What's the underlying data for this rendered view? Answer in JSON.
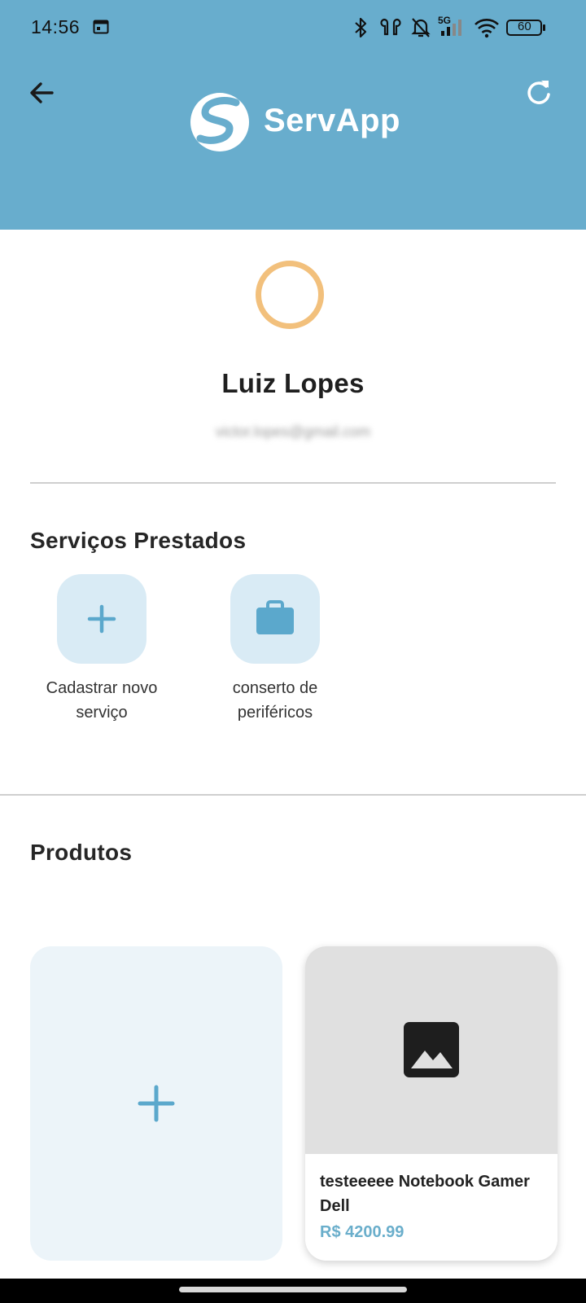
{
  "status_bar": {
    "time": "14:56",
    "network": "5G",
    "battery": "60"
  },
  "header": {
    "app_name": "ServApp",
    "background_color": "#68adcd"
  },
  "profile": {
    "name": "Luiz Lopes",
    "email": "victor.lopes@gmail.com",
    "avatar_ring_color": "#f2c07c"
  },
  "services": {
    "title": "Serviços Prestados",
    "items": [
      {
        "label_line1": "Cadastrar novo",
        "label_line2": "serviço",
        "icon": "plus-icon"
      },
      {
        "label_line1": "conserto de",
        "label_line2": "periféricos",
        "icon": "briefcase-icon"
      }
    ]
  },
  "products": {
    "title": "Produtos",
    "items": [
      {
        "title": "testeeeee Notebook Gamer Dell",
        "price": "R$ 4200.99",
        "icon": "image-placeholder-icon"
      }
    ],
    "accent_color": "#6aaecb"
  }
}
